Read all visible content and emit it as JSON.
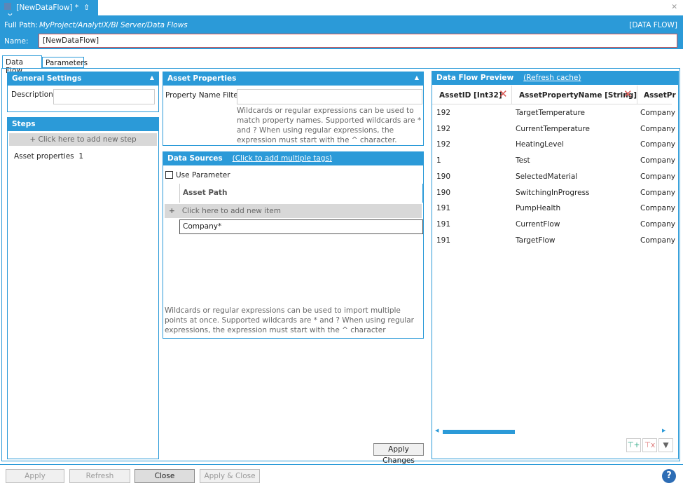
{
  "window": {
    "tab_title": "[NewDataFlow] *",
    "type_label": "[DATA FLOW]"
  },
  "header": {
    "full_path_label": "Full Path:",
    "full_path": "MyProject/AnalytiX/BI Server/Data Flows",
    "name_label": "Name:",
    "name_value": "[NewDataFlow]"
  },
  "tabs": [
    {
      "label": "Data Flow"
    },
    {
      "label": "Parameters"
    }
  ],
  "general": {
    "title": "General Settings",
    "description_label": "Description:",
    "description_value": ""
  },
  "steps": {
    "title": "Steps",
    "add_label": "Click here to add new step",
    "items": [
      {
        "label": "Asset properties",
        "count": "1"
      }
    ]
  },
  "asset_properties": {
    "title": "Asset Properties",
    "filter_label": "Property Name Filter:",
    "filter_value": "",
    "note": "Wildcards or regular expressions can be used to match property names. Supported wildcards are * and ? When using regular expressions, the expression must start with the ^ character."
  },
  "data_sources": {
    "title": "Data Sources",
    "multi_link": "(Click to add multiple tags)",
    "use_parameter": "Use Parameter",
    "column": "Asset Path",
    "add_label": "Click here to add new item",
    "items": [
      "Company*"
    ],
    "note": "Wildcards or regular expressions can be used to import multiple points at once. Supported wildcards are * and ? When using regular expressions, the expression must start with the ^ character"
  },
  "apply_changes": "Apply Changes",
  "preview": {
    "title": "Data Flow Preview",
    "refresh_link": "(Refresh cache)",
    "columns": [
      "AssetID  [Int32]",
      "AssetPropertyName  [String]",
      "AssetPr"
    ],
    "rows": [
      [
        "192",
        "TargetTemperature",
        "Company"
      ],
      [
        "192",
        "CurrentTemperature",
        "Company"
      ],
      [
        "192",
        "HeatingLevel",
        "Company"
      ],
      [
        "1",
        "Test",
        "Company"
      ],
      [
        "190",
        "SelectedMaterial",
        "Company"
      ],
      [
        "190",
        "SwitchingInProgress",
        "Company"
      ],
      [
        "191",
        "PumpHealth",
        "Company"
      ],
      [
        "191",
        "CurrentFlow",
        "Company"
      ],
      [
        "191",
        "TargetFlow",
        "Company"
      ]
    ]
  },
  "footer": {
    "apply": "Apply",
    "refresh": "Refresh",
    "close": "Close",
    "apply_close": "Apply & Close",
    "help": "?"
  }
}
